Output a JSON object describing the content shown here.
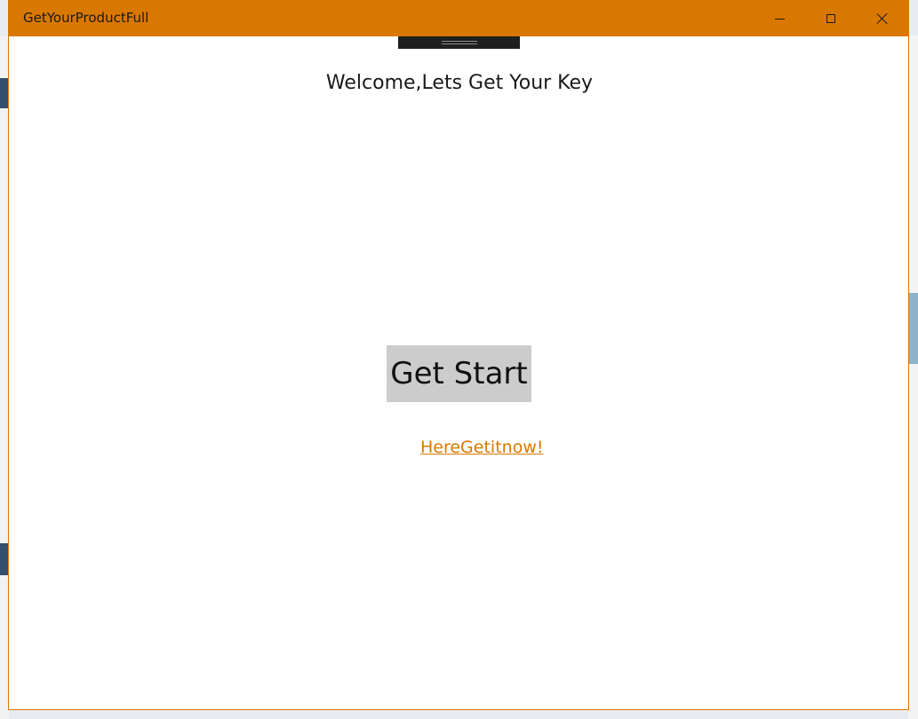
{
  "window": {
    "title": "GetYourProductFull",
    "accent_color": "#d97800",
    "controls": {
      "minimize_icon": "minimize-icon",
      "maximize_icon": "maximize-icon",
      "close_icon": "close-icon"
    }
  },
  "main": {
    "welcome_text": "Welcome,Lets Get Your Key",
    "start_button_label": "Get Start",
    "link_text": "HereGetitnow!"
  }
}
